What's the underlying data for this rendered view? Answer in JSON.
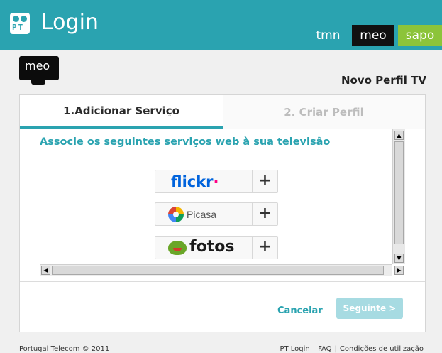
{
  "header": {
    "title": "Login",
    "logo_text": "PT",
    "brands": [
      "tmn",
      "meo",
      "sapo"
    ]
  },
  "meo_logo_text": "meo",
  "profile_title": "Novo Perfil TV",
  "tabs": [
    {
      "label": "1.Adicionar Serviço",
      "active": true
    },
    {
      "label": "2. Criar Perfil",
      "active": false
    }
  ],
  "services_heading": "Associe os seguintes serviços web à sua televisão",
  "services": [
    {
      "name": "flickr",
      "icon": "flickr-logo",
      "action": "+"
    },
    {
      "name": "Picasa",
      "icon": "picasa-icon",
      "action": "+"
    },
    {
      "name": "fotos",
      "icon": "frog-icon",
      "action": "+"
    }
  ],
  "buttons": {
    "cancel": "Cancelar",
    "next": "Seguinte >"
  },
  "footer": {
    "copyright": "Portugal Telecom © 2011",
    "links": [
      "PT Login",
      "FAQ",
      "Condições de utilização"
    ]
  },
  "colors": {
    "accent": "#2aa3b0",
    "sapo_green": "#8cc43a",
    "next_disabled": "#a7dbe2"
  }
}
